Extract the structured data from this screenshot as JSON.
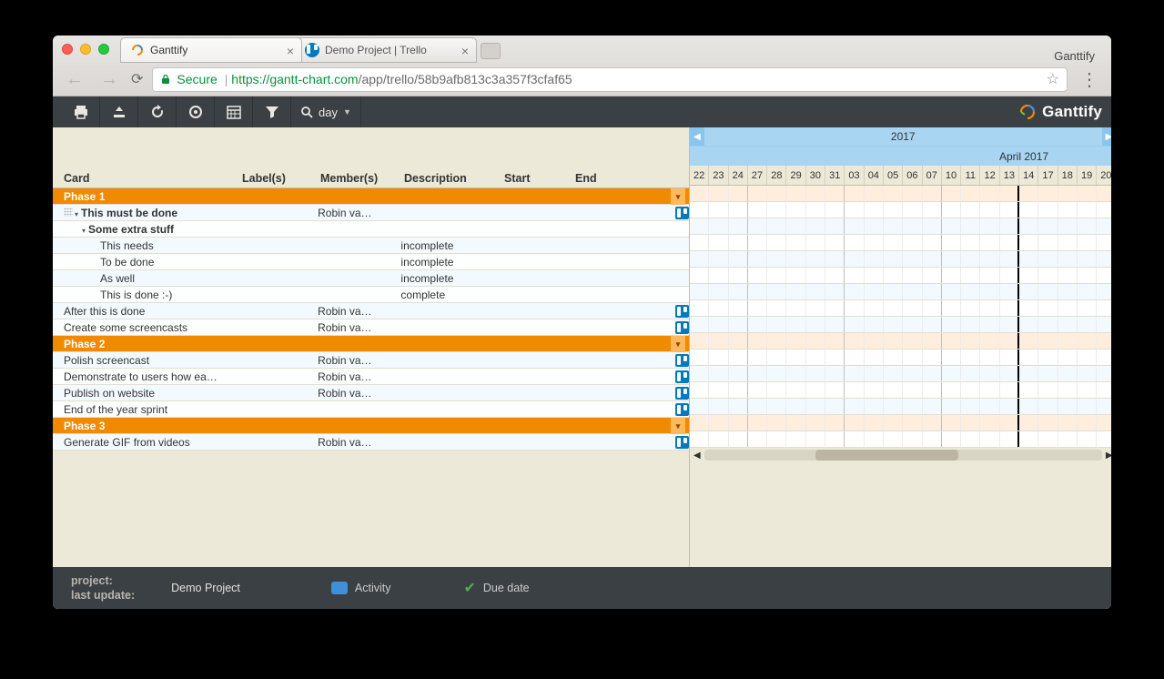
{
  "browser": {
    "tabs": [
      {
        "title": "Ganttify"
      },
      {
        "title": "Demo Project | Trello"
      }
    ],
    "right_label": "Ganttify",
    "secure_label": "Secure",
    "url_host": "https://gantt-chart.com",
    "url_path": "/app/trello/58b9afb813c3a357f3cfaf65"
  },
  "toolbar": {
    "zoom_label": "day"
  },
  "brand": "Ganttify",
  "columns": {
    "card": "Card",
    "labels": "Label(s)",
    "members": "Member(s)",
    "description": "Description",
    "start": "Start",
    "end": "End"
  },
  "timeline": {
    "year": "2017",
    "month": "April 2017",
    "days": [
      "22",
      "23",
      "24",
      "27",
      "28",
      "29",
      "30",
      "31",
      "03",
      "04",
      "05",
      "06",
      "07",
      "10",
      "11",
      "12",
      "13",
      "14",
      "17",
      "18",
      "19",
      "20"
    ]
  },
  "rows": [
    {
      "type": "phase",
      "card": "Phase 1"
    },
    {
      "type": "task",
      "card": "This must be done",
      "members": "Robin va…",
      "bold": true,
      "indent": 1,
      "drag": true,
      "tree": true,
      "icon": true,
      "alt": false
    },
    {
      "type": "task",
      "card": "Some extra stuff",
      "bold": true,
      "indent": 2,
      "tree": true,
      "alt": true
    },
    {
      "type": "task",
      "card": "This needs",
      "description": "incomplete",
      "indent": 3,
      "alt": false
    },
    {
      "type": "task",
      "card": "To be done",
      "description": "incomplete",
      "indent": 3,
      "alt": true
    },
    {
      "type": "task",
      "card": "As well",
      "description": "incomplete",
      "indent": 3,
      "alt": false
    },
    {
      "type": "task",
      "card": "This is done :-)",
      "description": "complete",
      "indent": 3,
      "alt": true
    },
    {
      "type": "task",
      "card": "After this is done",
      "members": "Robin va…",
      "icon": true,
      "indent": 1,
      "alt": false
    },
    {
      "type": "task",
      "card": "Create some screencasts",
      "members": "Robin va…",
      "icon": true,
      "indent": 1,
      "alt": true
    },
    {
      "type": "phase",
      "card": "Phase 2"
    },
    {
      "type": "task",
      "card": "Polish screencast",
      "members": "Robin va…",
      "icon": true,
      "indent": 1,
      "alt": false
    },
    {
      "type": "task",
      "card": "Demonstrate to users how ea…",
      "members": "Robin va…",
      "icon": true,
      "indent": 1,
      "alt": true
    },
    {
      "type": "task",
      "card": "Publish on website",
      "members": "Robin va…",
      "icon": true,
      "indent": 1,
      "alt": false
    },
    {
      "type": "task",
      "card": "End of the year sprint",
      "icon": true,
      "indent": 1,
      "alt": true
    },
    {
      "type": "phase",
      "card": "Phase 3"
    },
    {
      "type": "task",
      "card": "Generate GIF from videos",
      "members": "Robin va…",
      "icon": true,
      "indent": 1,
      "alt": false
    }
  ],
  "footer": {
    "project_label": "project:",
    "project_value": "Demo Project",
    "lastupdate_label": "last update:",
    "legend_activity": "Activity",
    "legend_due": "Due date"
  }
}
